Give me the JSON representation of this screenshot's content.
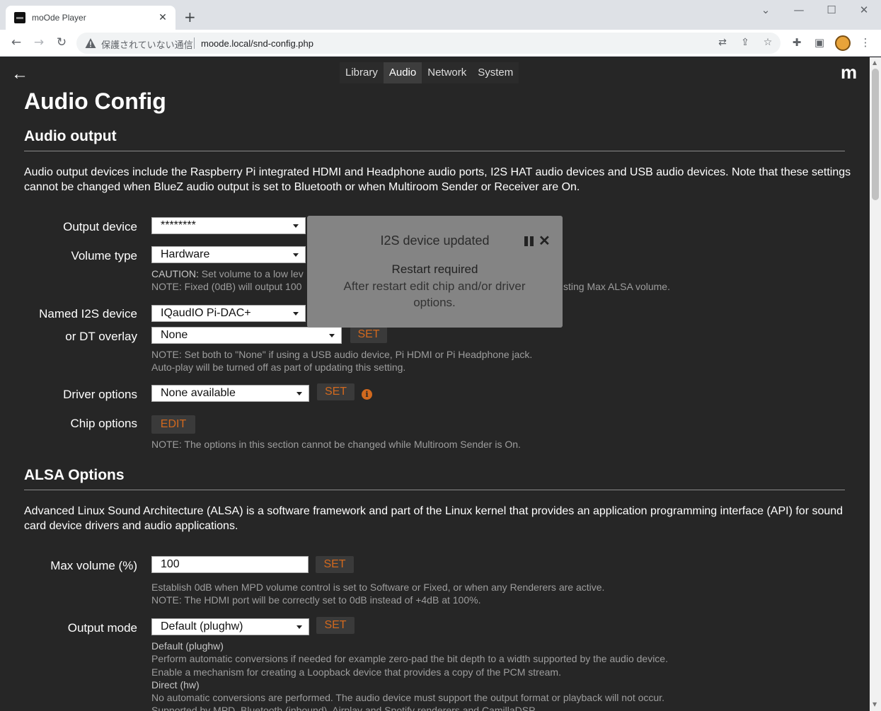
{
  "browser": {
    "tab_title": "moOde Player",
    "tab_close": "✕",
    "new_tab": "+",
    "security_text": "保護されていない通信",
    "url": "moode.local/snd-config.php"
  },
  "header": {
    "back": "←",
    "logo": "m",
    "nav": [
      "Library",
      "Audio",
      "Network",
      "System"
    ],
    "active_nav": "Audio"
  },
  "page_title": "Audio Config",
  "audio_output": {
    "title": "Audio output",
    "description": "Audio output devices include the Raspberry Pi integrated HDMI and Headphone audio ports, I2S HAT audio devices and USB audio devices. Note that these settings cannot be changed when BlueZ audio output is set to Bluetooth or when Multiroom Sender or Receiver are On.",
    "output_device": {
      "label": "Output device",
      "value": "********"
    },
    "volume_type": {
      "label": "Volume type",
      "value": "Hardware",
      "caution_bold": "CAUTION:",
      "caution_text": " Set volume to a low lev",
      "note_text": "NOTE: Fixed (0dB) will output 100",
      "note_tail": "sting Max ALSA volume."
    },
    "named_i2s": {
      "label": "Named I2S device",
      "value": "IQaudIO Pi-DAC+"
    },
    "dt_overlay": {
      "label": "or DT overlay",
      "value": "None",
      "button": "SET",
      "note1": "NOTE: Set both to \"None\" if using a USB audio device, Pi HDMI or Pi Headphone jack.",
      "note2": "Auto-play will be turned off as part of updating this setting."
    },
    "driver_options": {
      "label": "Driver options",
      "value": "None available",
      "button": "SET"
    },
    "chip_options": {
      "label": "Chip options",
      "button": "EDIT",
      "note": "NOTE: The options in this section cannot be changed while Multiroom Sender is On."
    }
  },
  "alsa": {
    "title": "ALSA Options",
    "description": "Advanced Linux Sound Architecture (ALSA) is a software framework and part of the Linux kernel that provides an application programming interface (API) for sound card device drivers and audio applications.",
    "max_volume": {
      "label": "Max volume (%)",
      "value": "100",
      "button": "SET",
      "note1": "Establish 0dB when MPD volume control is set to Software or Fixed, or when any Renderers are active.",
      "note2": "NOTE: The HDMI port will be correctly set to 0dB instead of +4dB at 100%."
    },
    "output_mode": {
      "label": "Output mode",
      "value": "Default (plughw)",
      "button": "SET",
      "default_title": "Default (plughw)",
      "default_line1": "Perform automatic conversions if needed for example zero-pad the bit depth to a width supported by the audio device.",
      "default_line2": "Enable a mechanism for creating a Loopback device that provides a copy of the PCM stream.",
      "direct_title": "Direct (hw)",
      "direct_line1": "No automatic conversions are performed. The audio device must support the output format or playback will not occur.",
      "direct_line2": "Supported by MPD, Bluetooth (inbound), Airplay and Spotify renderers and CamillaDSP"
    }
  },
  "toast": {
    "title": "I2S device updated",
    "line1": "Restart required",
    "line2": "After restart edit chip and/or driver options."
  },
  "colors": {
    "page_bg": "#262626",
    "accent": "#d2691e",
    "note_text": "#9d9d9d",
    "toast_bg": "#8c8c8c"
  }
}
